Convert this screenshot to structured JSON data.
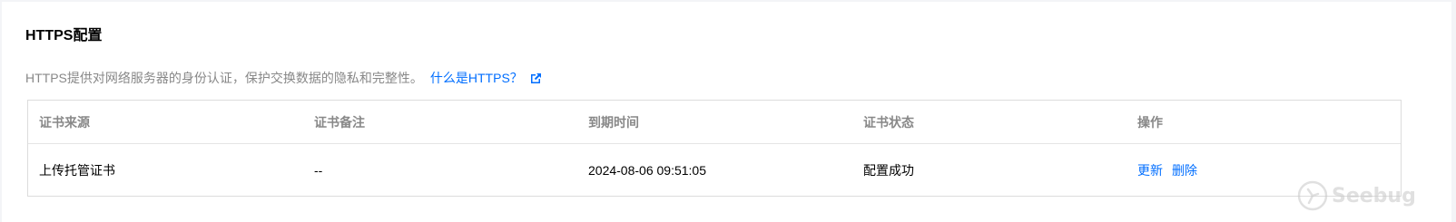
{
  "section": {
    "title": "HTTPS配置",
    "description": "HTTPS提供对网络服务器的身份认证，保护交换数据的隐私和完整性。",
    "help_link": "什么是HTTPS？"
  },
  "table": {
    "headers": [
      "证书来源",
      "证书备注",
      "到期时间",
      "证书状态",
      "操作"
    ],
    "rows": [
      {
        "source": "上传托管证书",
        "remark": "--",
        "expire_time": "2024-08-06 09:51:05",
        "status": "配置成功",
        "actions": [
          "更新",
          "删除"
        ]
      }
    ]
  },
  "watermark": {
    "text": "Seebug"
  },
  "colors": {
    "link": "#006eff",
    "muted": "#888888",
    "border": "#dcdcdc",
    "background": "#f3f4f7"
  },
  "icons": {
    "help_link": "external-link-icon",
    "watermark": "seebug-logo-icon"
  }
}
